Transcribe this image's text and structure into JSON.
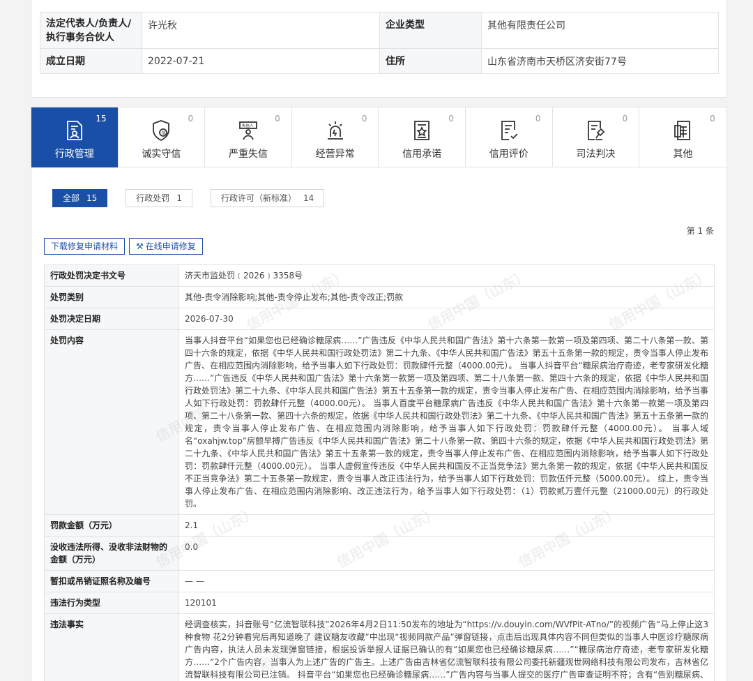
{
  "company_info": {
    "legal_rep_label": "法定代表人/负责人/执行事务合伙人",
    "legal_rep_label_line1": "法定代表人/负责人/",
    "legal_rep_label_line2": "执行事务合伙人",
    "legal_rep_value": "许光秋",
    "enterprise_type_label": "企业类型",
    "enterprise_type_value": "其他有限责任公司",
    "established_label": "成立日期",
    "established_value": "2022-07-21",
    "address_label": "住所",
    "address_value": "山东省济南市天桥区济安街77号"
  },
  "tabs": [
    {
      "label": "行政管理",
      "count": "15",
      "icon": "admin-document-icon",
      "active": true
    },
    {
      "label": "诚实守信",
      "count": "0",
      "icon": "shield-credit-icon",
      "active": false
    },
    {
      "label": "严重失信",
      "count": "0",
      "icon": "dishonest-person-icon",
      "active": false
    },
    {
      "label": "经营异常",
      "count": "0",
      "icon": "alarm-light-icon",
      "active": false
    },
    {
      "label": "信用承诺",
      "count": "0",
      "icon": "pledge-document-icon",
      "active": false
    },
    {
      "label": "信用评价",
      "count": "0",
      "icon": "evaluation-form-icon",
      "active": false
    },
    {
      "label": "司法判决",
      "count": "0",
      "icon": "judgment-document-icon",
      "active": false
    },
    {
      "label": "其他",
      "count": "0",
      "icon": "other-document-icon",
      "active": false
    }
  ],
  "filters": [
    {
      "label": "全部",
      "count": "15",
      "active": true
    },
    {
      "label": "行政处罚",
      "count": "1",
      "active": false
    },
    {
      "label": "行政许可（新标准）",
      "count": "14",
      "active": false
    }
  ],
  "page_count": "第 1 条",
  "buttons": {
    "download_label": "下载修复申请材料",
    "online_repair_label": "在线申请修复"
  },
  "watermark_text": "信用中国（山东）",
  "detail_rows": [
    {
      "label": "行政处罚决定书文号",
      "value": "济天市监处罚﹝2026﹞3358号"
    },
    {
      "label": "处罚类别",
      "value": "其他-责令消除影响;其他-责令停止发布;其他-责令改正;罚款"
    },
    {
      "label": "处罚决定日期",
      "value": "2026-07-30"
    },
    {
      "label": "处罚内容",
      "value": "当事人抖音平台“如果您也已经确诊糖尿病……”广告违反《中华人民共和国广告法》第十六条第一款第一项及第四项、第二十八条第一款、第四十六条的规定，依据《中华人民共和国行政处罚法》第二十九条、《中华人民共和国广告法》第五十五条第一款的规定，责令当事人停止发布广告、在相应范围内消除影响，给予当事人如下行政处罚：罚款肆仟元整（4000.00元）。 当事人抖音平台“糖尿病治疗奇迹，老专家研发化糖方……”广告违反《中华人民共和国广告法》第十六条第一款第一项及第四项、第二十八条第一款、第四十六条的规定，依据《中华人民共和国行政处罚法》第二十九条、《中华人民共和国广告法》第五十五条第一款的规定，责令当事人停止发布广告、在相应范围内消除影响，给予当事人如下行政处罚：罚款肆仟元整（4000.00元）。 当事人百度平台糖尿病广告违反《中华人民共和国广告法》第十六条第一款第一项及第四项、第二十八条第一款、第四十六条的规定，依据《中华人民共和国行政处罚法》第二十九条、《中华人民共和国广告法》第五十五条第一款的规定，责令当事人停止发布广告、在相应范围内消除影响，给予当事人如下行政处罚：罚款肆仟元整（4000.00元）。 当事人域名“oxahjw.top”房颤早搏广告违反《中华人民共和国广告法》第二十八条第一款、第四十六条的规定，依据《中华人民共和国行政处罚法》第二十九条、《中华人民共和国广告法》第五十五条第一款的规定，责令当事人停止发布广告、在相应范围内消除影响，给予当事人如下行政处罚：罚款肆仟元整（4000.00元）。 当事人虚假宣传违反《中华人民共和国反不正当竞争法》第九条第一款的规定，依据《中华人民共和国反不正当竞争法》第二十五条第一款规定，责令当事人改正违法行为，给予当事人如下行政处罚：罚款伍仟元整（5000.00元）。 综上，责令当事人停止发布广告、在相应范围内消除影响、改正违法行为，给予当事人如下行政处罚：（1）罚款贰万壹仟元整（21000.00元）的行政处罚。"
    },
    {
      "label": "罚款金额（万元）",
      "value": "2.1"
    },
    {
      "label": "没收违法所得、没收非法财物的金额（万元）",
      "value": "0.0"
    },
    {
      "label": "暂扣或吊销证照名称及编号",
      "value": "— —"
    },
    {
      "label": "违法行为类型",
      "value": "120101"
    },
    {
      "label": "违法事实",
      "value": "经调查核实，抖音账号“亿流智联科技”2026年4月2日11:50发布的地址为“https://v.douyin.com/WVfPit-ATno/”的视频广告“马上停止这3种食物 花2分钟看完后再知道晚了 建议糖友收藏”中出现“视频同款产品”弹窗链接，点击后出现具体内容不同但类似的当事人中医诊疗糖尿病广告内容，执法人员未发现弹窗链接，根据投诉举报人证据已确认的有“如果您也已经确诊糖尿病……”“糖尿病治疗奇迹，老专家研发化糖方……”2个广告内容，当事人为上述广告的广告主。上述广告由吉林省亿流智联科技有限公司委托新疆观世网络科技有限公司发布，吉林省亿流智联科技有限公司已注销。 抖音平台“如果您也已经确诊糖尿病……”广告内容与当事人提交的医疗广告审查证明不符；含有“告别糖尿病、并发症”等表示功效、安全性的断言或者保证；含有患者形象的照片；当事人无有效证据证明“帮助上万患者重获新生”等内容的真实性，否则属于虚假广告。"
    }
  ]
}
